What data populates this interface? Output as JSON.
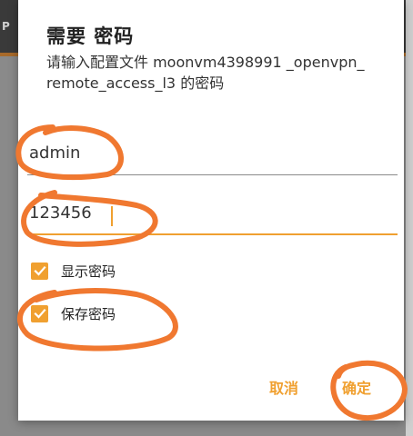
{
  "background": {
    "appbar_text": "P"
  },
  "dialog": {
    "title": "需要 密码",
    "message": "请输入配置文件 moonvm4398991 _openvpn_remote_access_l3 的密码",
    "username": {
      "value": "admin"
    },
    "password": {
      "value": "123456"
    },
    "show_password": {
      "label": "显示密码",
      "checked": true
    },
    "save_password": {
      "label": "保存密码",
      "checked": true
    },
    "buttons": {
      "cancel": "取消",
      "ok": "确定"
    }
  },
  "colors": {
    "accent": "#f0a030",
    "annotation": "#f07830"
  }
}
